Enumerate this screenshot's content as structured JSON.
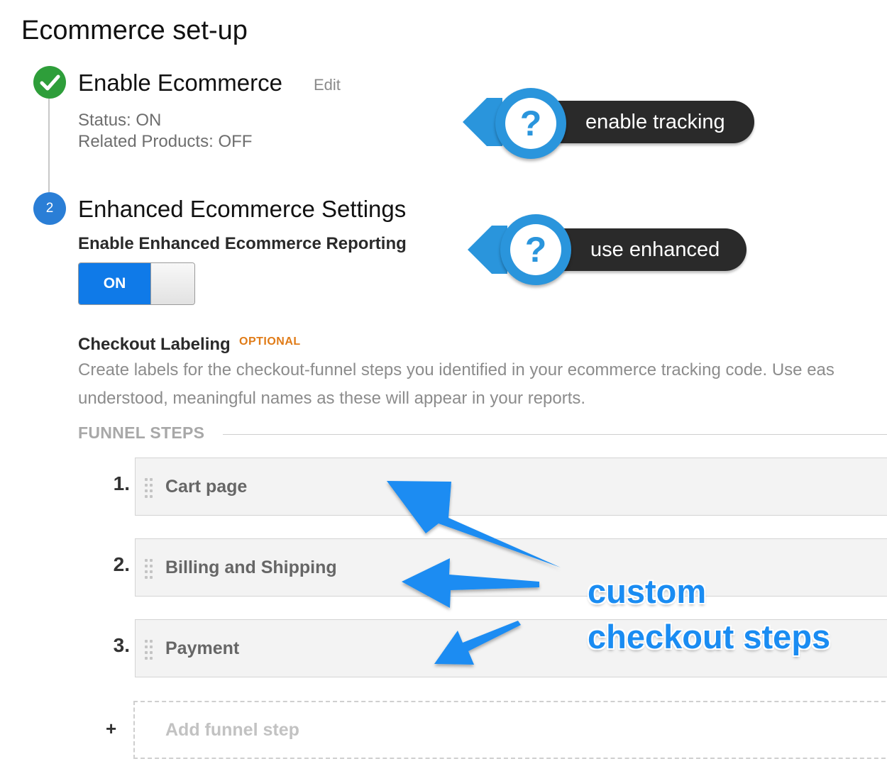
{
  "page_title": "Ecommerce set-up",
  "step1": {
    "number": "✓",
    "title": "Enable Ecommerce",
    "edit_label": "Edit",
    "status": "Status: ON",
    "related_products": "Related Products: OFF",
    "icon": "check-icon",
    "color": "#2e9e3a"
  },
  "step2": {
    "number": "2",
    "title": "Enhanced Ecommerce Settings",
    "reporting_label": "Enable Enhanced Ecommerce Reporting",
    "toggle_label": "ON",
    "toggle_on": true,
    "color": "#2a7ed6"
  },
  "checkout": {
    "label": "Checkout Labeling",
    "optional": "OPTIONAL",
    "desc_line1": "Create labels for the checkout-funnel steps you identified in your ecommerce tracking code. Use eas",
    "desc_line2": "understood, meaningful names as these will appear in your reports.",
    "funnel_steps_label": "FUNNEL STEPS",
    "steps": [
      {
        "num": "1.",
        "label": "Cart page"
      },
      {
        "num": "2.",
        "label": "Billing and Shipping"
      },
      {
        "num": "3.",
        "label": "Payment"
      }
    ],
    "add_plus": "+",
    "add_placeholder": "Add funnel step"
  },
  "callouts": [
    {
      "text": "enable tracking",
      "icon": "question-icon",
      "symbol": "?"
    },
    {
      "text": "use enhanced",
      "icon": "question-icon",
      "symbol": "?"
    }
  ],
  "annotation": {
    "line1": "custom",
    "line2": "checkout steps",
    "color": "#1a8cf2"
  }
}
